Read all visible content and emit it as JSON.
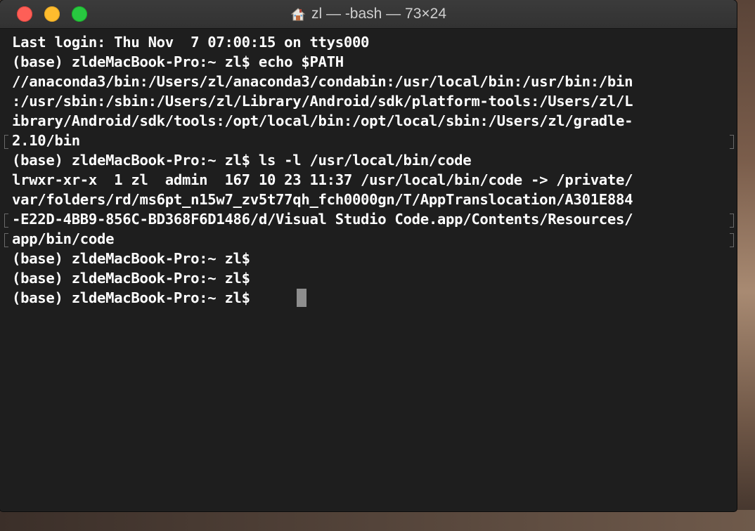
{
  "window": {
    "title": "zl — -bash — 73×24",
    "title_icon": "home-folder-icon",
    "traffic_lights": [
      "close",
      "minimize",
      "zoom"
    ],
    "colors": {
      "close": "#fe5f57",
      "minimize": "#febc2e",
      "zoom": "#28c840",
      "background": "#1e1e1e",
      "text": "#ffffff"
    }
  },
  "terminal": {
    "lines": [
      "Last login: Thu Nov  7 07:00:15 on ttys000",
      "(base) zldeMacBook-Pro:~ zl$ echo $PATH",
      "//anaconda3/bin:/Users/zl/anaconda3/condabin:/usr/local/bin:/usr/bin:/bin",
      ":/usr/sbin:/sbin:/Users/zl/Library/Android/sdk/platform-tools:/Users/zl/L",
      "ibrary/Android/sdk/tools:/opt/local/bin:/opt/local/sbin:/Users/zl/gradle-",
      "2.10/bin",
      "(base) zldeMacBook-Pro:~ zl$ ls -l /usr/local/bin/code",
      "lrwxr-xr-x  1 zl  admin  167 10 23 11:37 /usr/local/bin/code -> /private/",
      "var/folders/rd/ms6pt_n15w7_zv5t77qh_fch0000gn/T/AppTranslocation/A301E884",
      "-E22D-4BB9-856C-BD368F6D1486/d/Visual Studio Code.app/Contents/Resources/",
      "app/bin/code",
      "(base) zldeMacBook-Pro:~ zl$ ",
      "(base) zldeMacBook-Pro:~ zl$ ",
      "(base) zldeMacBook-Pro:~ zl$ "
    ]
  }
}
